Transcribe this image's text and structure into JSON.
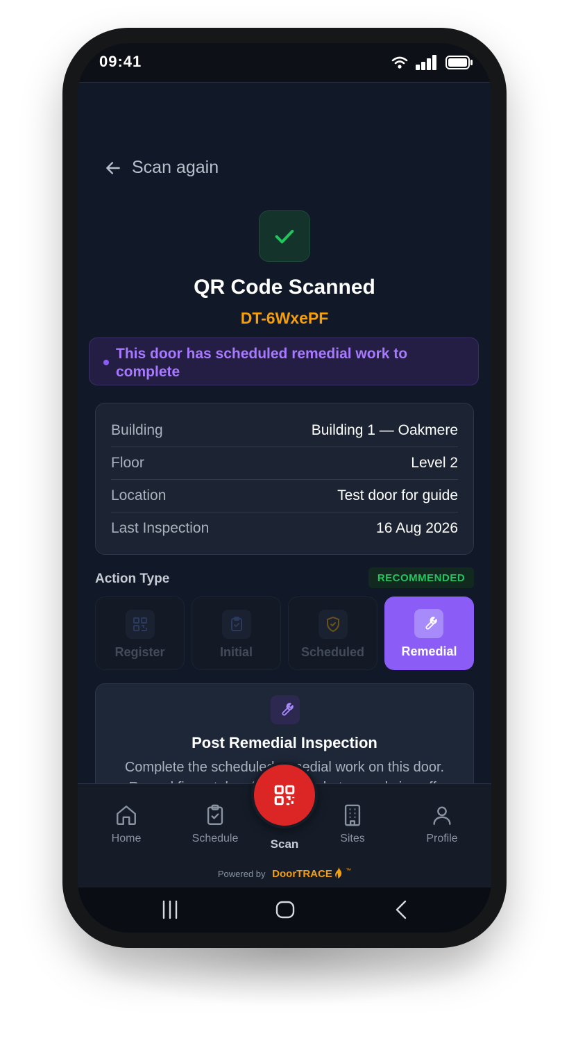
{
  "status_bar": {
    "time": "09:41"
  },
  "header": {
    "back_label": "Scan again"
  },
  "scan_result": {
    "title": "QR Code Scanned",
    "door_id": "DT-6WxePF",
    "notice": "This door has scheduled remedial work to complete"
  },
  "door_info": [
    {
      "label": "Building",
      "value": "Building 1 — Oakmere"
    },
    {
      "label": "Floor",
      "value": "Level 2"
    },
    {
      "label": "Location",
      "value": "Test door for guide"
    },
    {
      "label": "Last Inspection",
      "value": "16 Aug 2026"
    }
  ],
  "action_type": {
    "title": "Action Type",
    "badge": "RECOMMENDED",
    "options": [
      {
        "label": "Register",
        "icon": "qr-icon",
        "selected": false
      },
      {
        "label": "Initial",
        "icon": "clipboard-icon",
        "selected": false
      },
      {
        "label": "Scheduled",
        "icon": "shield-icon",
        "selected": false
      },
      {
        "label": "Remedial",
        "icon": "wrench-icon",
        "selected": true
      }
    ]
  },
  "detail": {
    "title": "Post Remedial Inspection",
    "description": "Complete the scheduled remedial work on this door. Record fixes, take after-repair photos, and sign off."
  },
  "bottom_nav": {
    "items": [
      {
        "label": "Home",
        "icon": "home-icon"
      },
      {
        "label": "Schedule",
        "icon": "clipboard-check-icon"
      },
      {
        "label": "Scan",
        "icon": "qr-scan-icon"
      },
      {
        "label": "Sites",
        "icon": "building-icon"
      },
      {
        "label": "Profile",
        "icon": "user-icon"
      }
    ]
  },
  "footer": {
    "powered_by": "Powered by",
    "brand": "DoorTRACE",
    "brand_tm": "™"
  },
  "colors": {
    "accent_purple": "#8b5cf6",
    "door_id_orange": "#f59e0b",
    "success_green": "#22c55e",
    "scan_red": "#dc2626",
    "background": "#111827"
  }
}
